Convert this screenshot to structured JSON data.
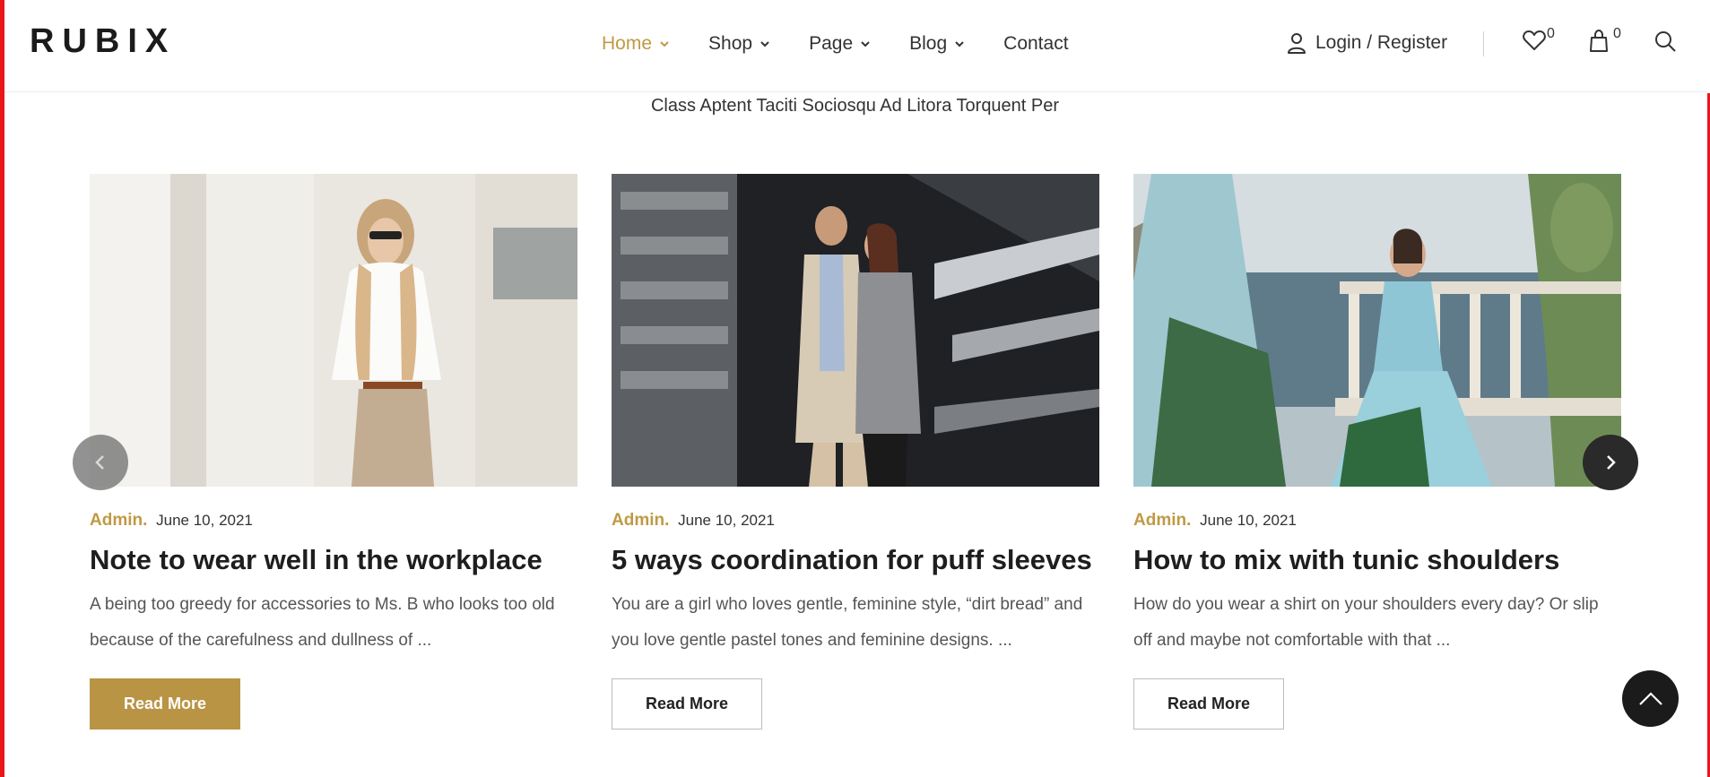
{
  "brand": {
    "logo": "RUBIX"
  },
  "nav": {
    "items": [
      {
        "label": "Home",
        "active": true
      },
      {
        "label": "Shop"
      },
      {
        "label": "Page"
      },
      {
        "label": "Blog"
      },
      {
        "label": "Contact"
      }
    ],
    "account_label": "Login / Register",
    "wishlist_count": "0",
    "cart_count": "0"
  },
  "section": {
    "subtitle": "Class Aptent Taciti Sociosqu Ad Litora Torquent Per"
  },
  "posts": [
    {
      "author": "Admin.",
      "date": "June 10, 2021",
      "title": "Note to wear well in the workplace",
      "excerpt": "A being too greedy for accessories to Ms. B who looks too old because of the carefulness and dullness of ...",
      "button": "Read More"
    },
    {
      "author": "Admin.",
      "date": "June 10, 2021",
      "title": "5 ways coordination for puff sleeves",
      "excerpt": "You are a girl who loves gentle, feminine style, “dirt bread” and you love gentle pastel tones and feminine designs. ...",
      "button": "Read More"
    },
    {
      "author": "Admin.",
      "date": "June 10, 2021",
      "title": "How to mix with tunic shoulders",
      "excerpt": "How do you wear a shirt on your shoulders every day? Or slip off and maybe not comfortable with that ...",
      "button": "Read More"
    }
  ],
  "colors": {
    "accent": "#bf9a45",
    "button_primary": "#b99444",
    "dark": "#1b1b1b",
    "edge": "#e8161b"
  },
  "icons": {
    "nav_dropdown": "chevron-down-icon",
    "account": "user-icon",
    "wishlist": "heart-icon",
    "cart": "shopping-bag-icon",
    "search": "search-icon",
    "carousel_prev": "chevron-left-icon",
    "carousel_next": "chevron-right-icon",
    "back_to_top": "chevron-up-icon"
  }
}
